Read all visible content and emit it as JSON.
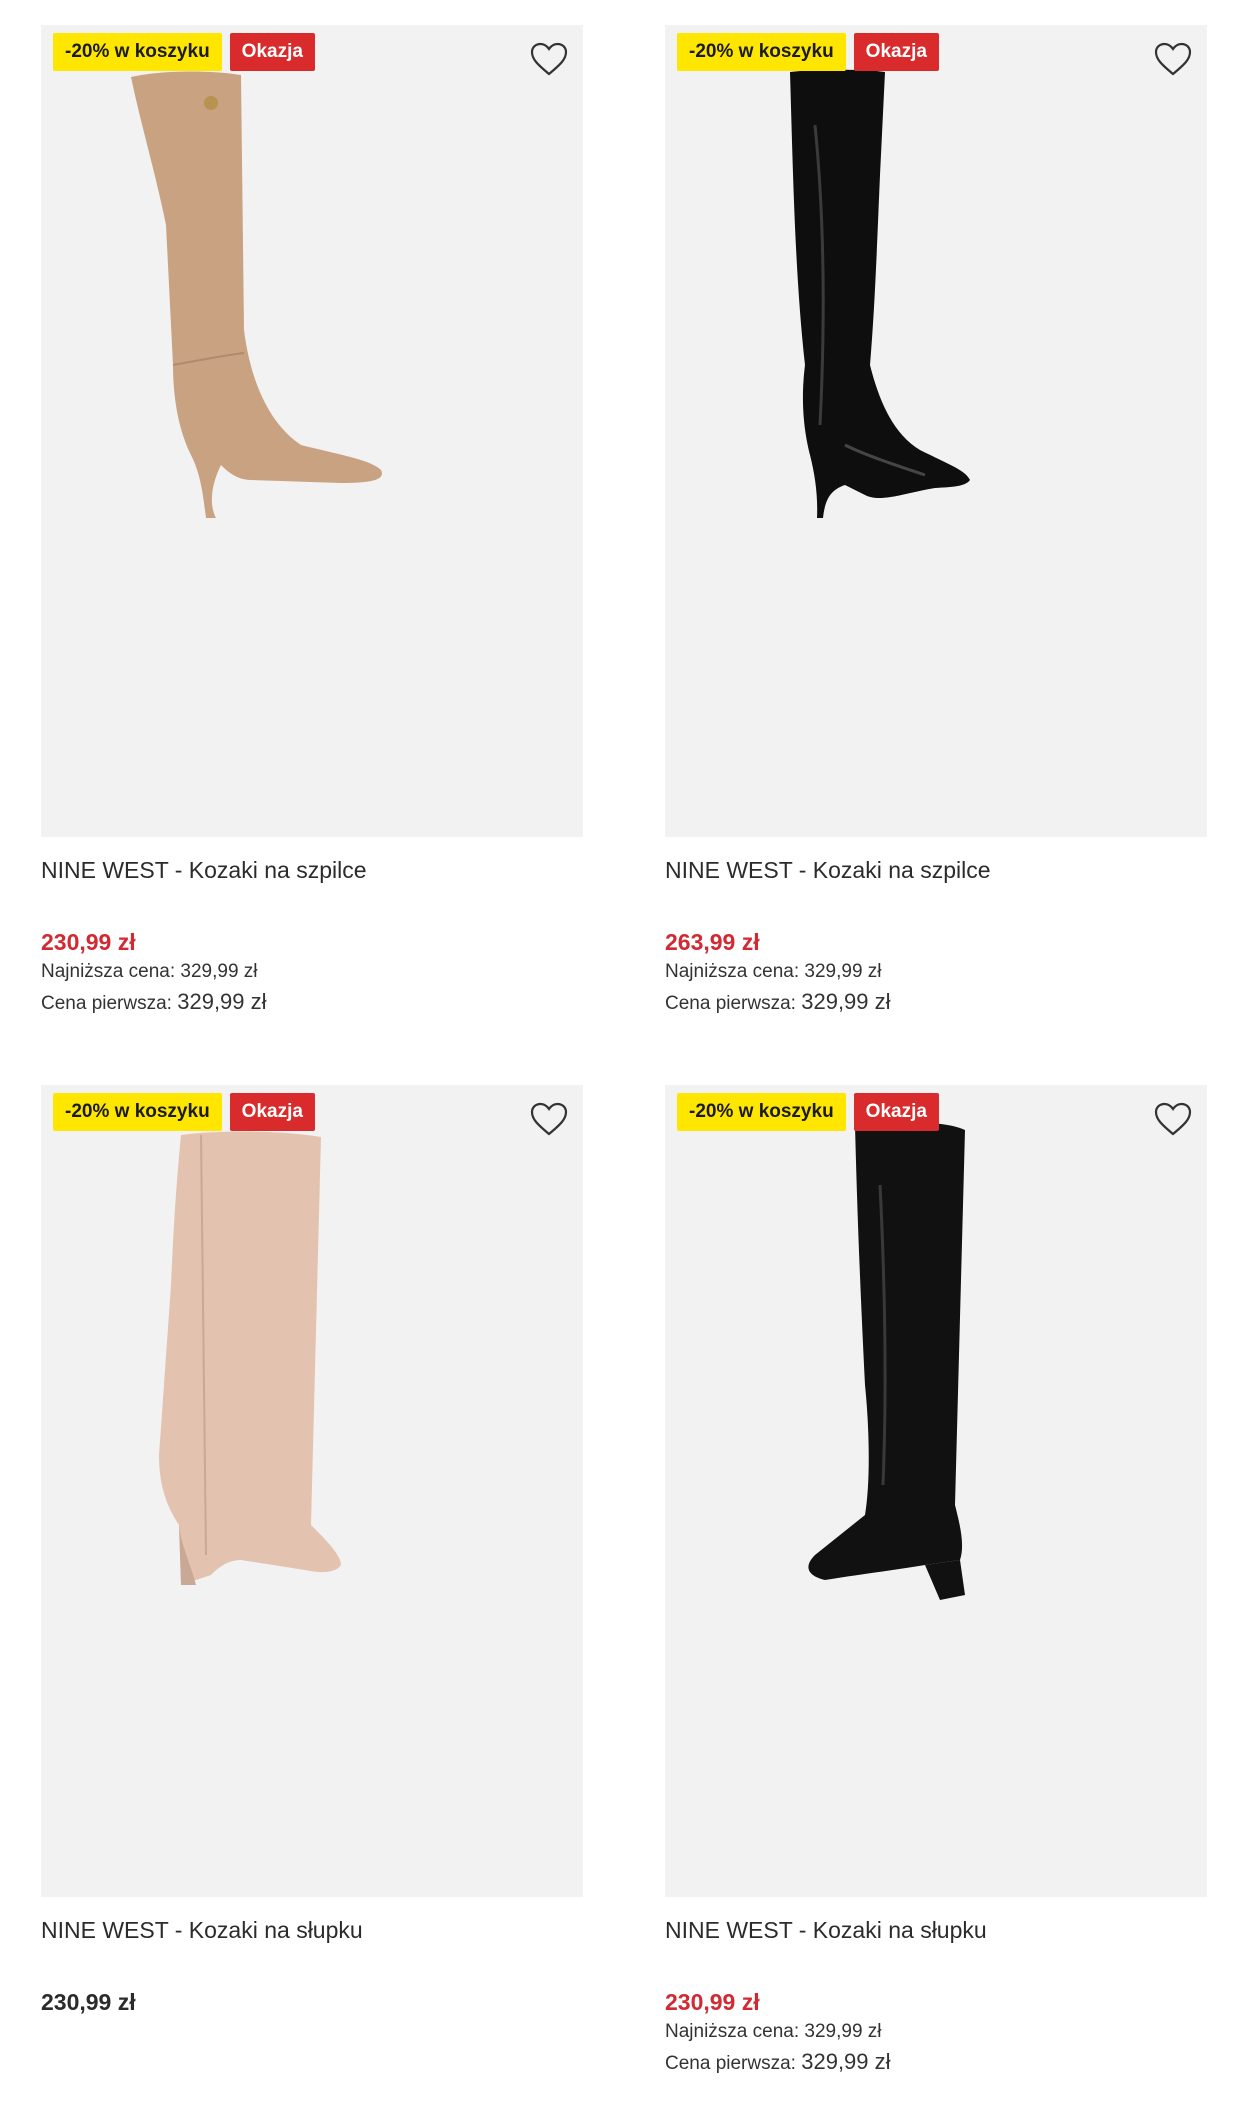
{
  "products": [
    {
      "badge_promo": "-20% w koszyku",
      "badge_deal": "Okazja",
      "title": "NINE WEST - Kozaki na szpilce",
      "price": "230,99 zł",
      "lowest_label": "Najniższa cena:",
      "lowest_value": "329,99 zł",
      "first_label": "Cena pierwsza:",
      "first_value": "329,99 zł",
      "boot_color": "#c9a282"
    },
    {
      "badge_promo": "-20% w koszyku",
      "badge_deal": "Okazja",
      "title": "NINE WEST - Kozaki na szpilce",
      "price": "263,99 zł",
      "lowest_label": "Najniższa cena:",
      "lowest_value": "329,99 zł",
      "first_label": "Cena pierwsza:",
      "first_value": "329,99 zł",
      "boot_color": "#0e0e0e"
    },
    {
      "badge_promo": "-20% w koszyku",
      "badge_deal": "Okazja",
      "title": "NINE WEST - Kozaki na słupku",
      "price": "230,99 zł",
      "boot_color": "#e3c3b0"
    },
    {
      "badge_promo": "-20% w koszyku",
      "badge_deal": "Okazja",
      "title": "NINE WEST - Kozaki na słupku",
      "price": "230,99 zł",
      "lowest_label": "Najniższa cena:",
      "lowest_value": "329,99 zł",
      "first_label": "Cena pierwsza:",
      "first_value": "329,99 zł",
      "boot_color": "#111111"
    }
  ],
  "colors": {
    "sale_price": "#d22a32",
    "promo_badge": "#ffe600",
    "deal_badge": "#d92b2b",
    "image_bg": "#f2f2f2"
  },
  "icons": {
    "favorite": "heart-outline-icon"
  }
}
